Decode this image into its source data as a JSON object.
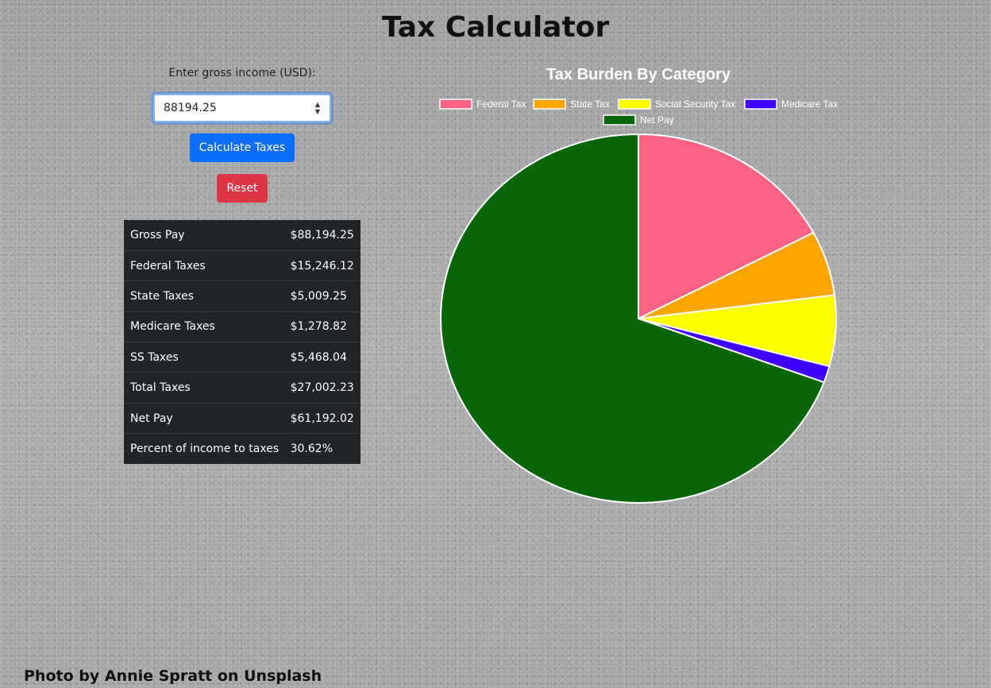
{
  "page": {
    "title": "Tax Calculator",
    "credit": "Photo by Annie Spratt on Unsplash"
  },
  "form": {
    "income_label": "Enter gross income (USD):",
    "income_value": "88194.25",
    "calculate_label": "Calculate Taxes",
    "reset_label": "Reset"
  },
  "results": [
    {
      "label": "Gross Pay",
      "value": "$88,194.25"
    },
    {
      "label": "Federal Taxes",
      "value": "$15,246.12"
    },
    {
      "label": "State Taxes",
      "value": "$5,009.25"
    },
    {
      "label": "Medicare Taxes",
      "value": "$1,278.82"
    },
    {
      "label": "SS Taxes",
      "value": "$5,468.04"
    },
    {
      "label": "Total Taxes",
      "value": "$27,002.23"
    },
    {
      "label": "Net Pay",
      "value": "$61,192.02"
    },
    {
      "label": "Percent of income to taxes",
      "value": "30.62%"
    }
  ],
  "chart_data": {
    "type": "pie",
    "title": "Tax Burden By Category",
    "legend_position": "top",
    "categories": [
      "Federal Tax",
      "State Tax",
      "Social Security Tax",
      "Medicare Tax",
      "Net Pay"
    ],
    "values": [
      15246.12,
      5009.25,
      5468.04,
      1278.82,
      61192.02
    ],
    "colors": [
      "#ff6384",
      "#ffa500",
      "#ffff00",
      "#3f00ff",
      "#086608"
    ]
  }
}
